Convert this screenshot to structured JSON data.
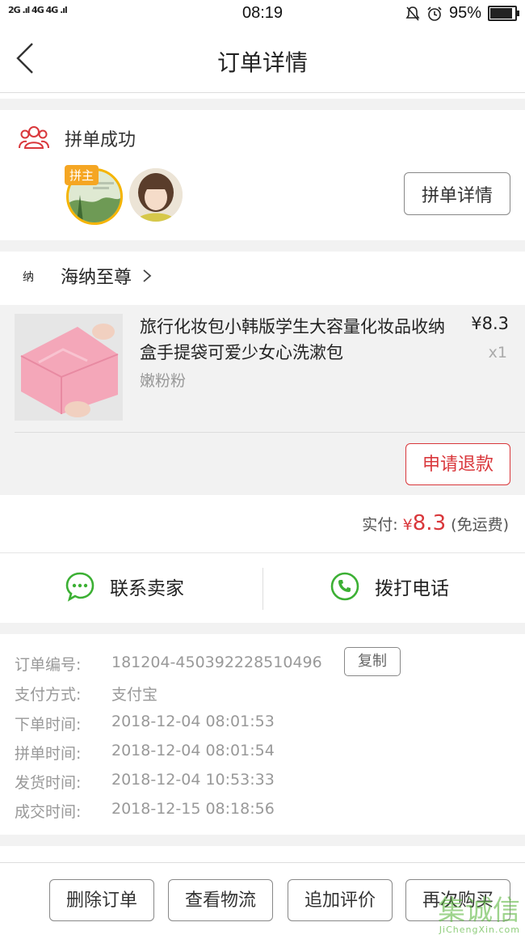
{
  "status_bar": {
    "network": "2G .ıl 4G 4G .ıl",
    "time": "08:19",
    "battery": "95%",
    "battery_level": 0.95
  },
  "header": {
    "title": "订单详情"
  },
  "group": {
    "status": "拼单成功",
    "leader_badge": "拼主",
    "details_button": "拼单详情"
  },
  "shop": {
    "icon_text": "纳",
    "name": "海纳至尊"
  },
  "product": {
    "title": "旅行化妆包小韩版学生大容量化妆品收纳盒手提袋可爱少女心洗漱包",
    "price": "¥8.3",
    "qty": "x1",
    "spec": "嫩粉粉",
    "refund_button": "申请退款"
  },
  "payment": {
    "label": "实付:",
    "currency": "¥",
    "amount": "8.3",
    "shipping_note": "(免运费)"
  },
  "contact": {
    "seller_label": "联系卖家",
    "phone_label": "拨打电话"
  },
  "order_info": {
    "copy_button": "复制",
    "rows": [
      {
        "label": "订单编号:",
        "value": "181204-450392228510496"
      },
      {
        "label": "支付方式:",
        "value": "支付宝"
      },
      {
        "label": "下单时间:",
        "value": "2018-12-04 08:01:53"
      },
      {
        "label": "拼单时间:",
        "value": "2018-12-04 08:01:54"
      },
      {
        "label": "发货时间:",
        "value": "2018-12-04 10:53:33"
      },
      {
        "label": "成交时间:",
        "value": "2018-12-15 08:18:56"
      }
    ]
  },
  "bottom_actions": {
    "delete": "删除订单",
    "logistics": "查看物流",
    "review": "追加评价",
    "rebuy": "再次购买"
  },
  "watermark": {
    "main": "集诚信",
    "sub": "JiChengXin.com"
  },
  "colors": {
    "accent_red": "#d9373b",
    "wechat_green": "#3cb034",
    "badge_orange": "#f5a623"
  }
}
